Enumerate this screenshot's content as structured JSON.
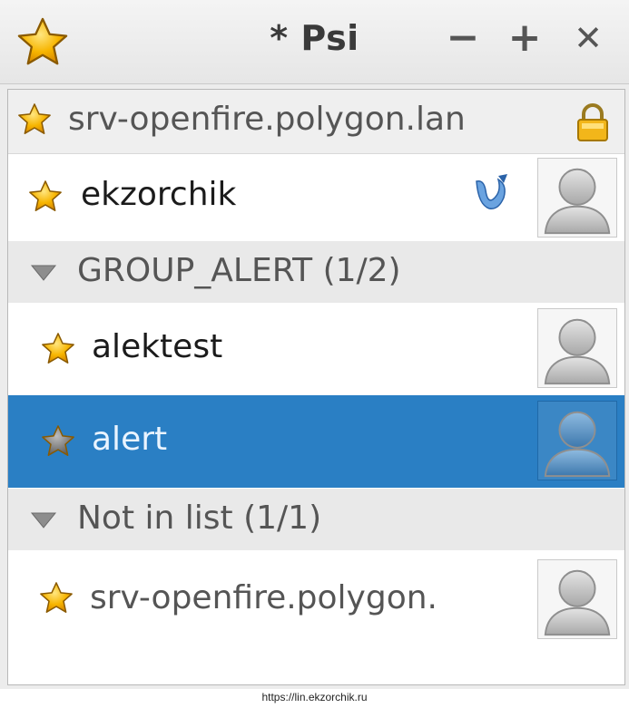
{
  "window": {
    "title": "* Psi",
    "minimize_label": "−",
    "maximize_label": "+",
    "close_label": "✕"
  },
  "account": {
    "name": "srv-openfire.polygon.lan",
    "icons": [
      "star-icon",
      "lock-icon"
    ]
  },
  "roster": {
    "self_contact": {
      "name": "ekzorchik",
      "status_icon": "star-icon",
      "client_icon": "client-icon"
    },
    "groups": [
      {
        "label": "GROUP_ALERT (1/2)",
        "contacts": [
          {
            "name": "alektest",
            "status": "online"
          },
          {
            "name": "alert",
            "status": "offline",
            "selected": true
          }
        ]
      },
      {
        "label": "Not in list (1/1)",
        "contacts": [
          {
            "name": "srv-openfire.polygon.",
            "status": "online"
          }
        ]
      }
    ]
  },
  "footer": {
    "url": "https://lin.ekzorchik.ru"
  },
  "colors": {
    "selection": "#2a7fc4",
    "star_online": "#f5b400",
    "star_offline": "#7a7a7a"
  }
}
